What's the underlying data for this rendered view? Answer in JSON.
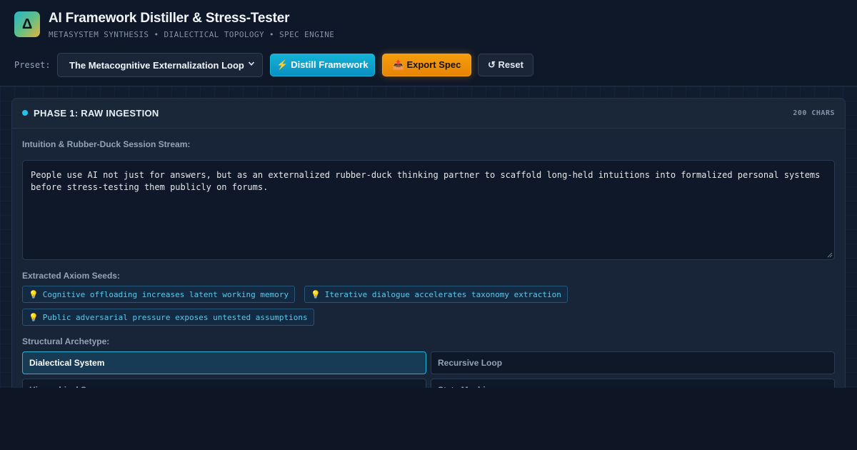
{
  "header": {
    "logo_glyph": "Δ",
    "title": "AI Framework Distiller & Stress-Tester",
    "subtitle": "METASYSTEM SYNTHESIS • DIALECTICAL TOPOLOGY • SPEC ENGINE"
  },
  "toolbar": {
    "preset_label": "Preset:",
    "preset_selected": "The Metacognitive Externalization Loop",
    "distill_label": "⚡ Distill Framework",
    "export_label": "📤 Export Spec",
    "reset_label": "↺ Reset"
  },
  "phase1": {
    "title": "PHASE 1: RAW INGESTION",
    "char_count": "200 CHARS",
    "stream_label": "Intuition & Rubber-Duck Session Stream:",
    "stream_text": "People use AI not just for answers, but as an externalized rubber-duck thinking partner to scaffold long-held intuitions into formalized personal systems before stress-testing them publicly on forums.",
    "seeds_label": "Extracted Axiom Seeds:",
    "seeds": [
      "Cognitive offloading increases latent working memory",
      "Iterative dialogue accelerates taxonomy extraction",
      "Public adversarial pressure exposes untested assumptions"
    ],
    "archetype_label": "Structural Archetype:",
    "archetypes": [
      "Dialectical System",
      "Recursive Loop",
      "Hierarchical Spec",
      "State Machine"
    ],
    "archetype_selected": "Dialectical System"
  },
  "colors": {
    "accent_cyan": "#14b3d6",
    "accent_amber": "#f59e0b",
    "background": "#0e1626"
  }
}
